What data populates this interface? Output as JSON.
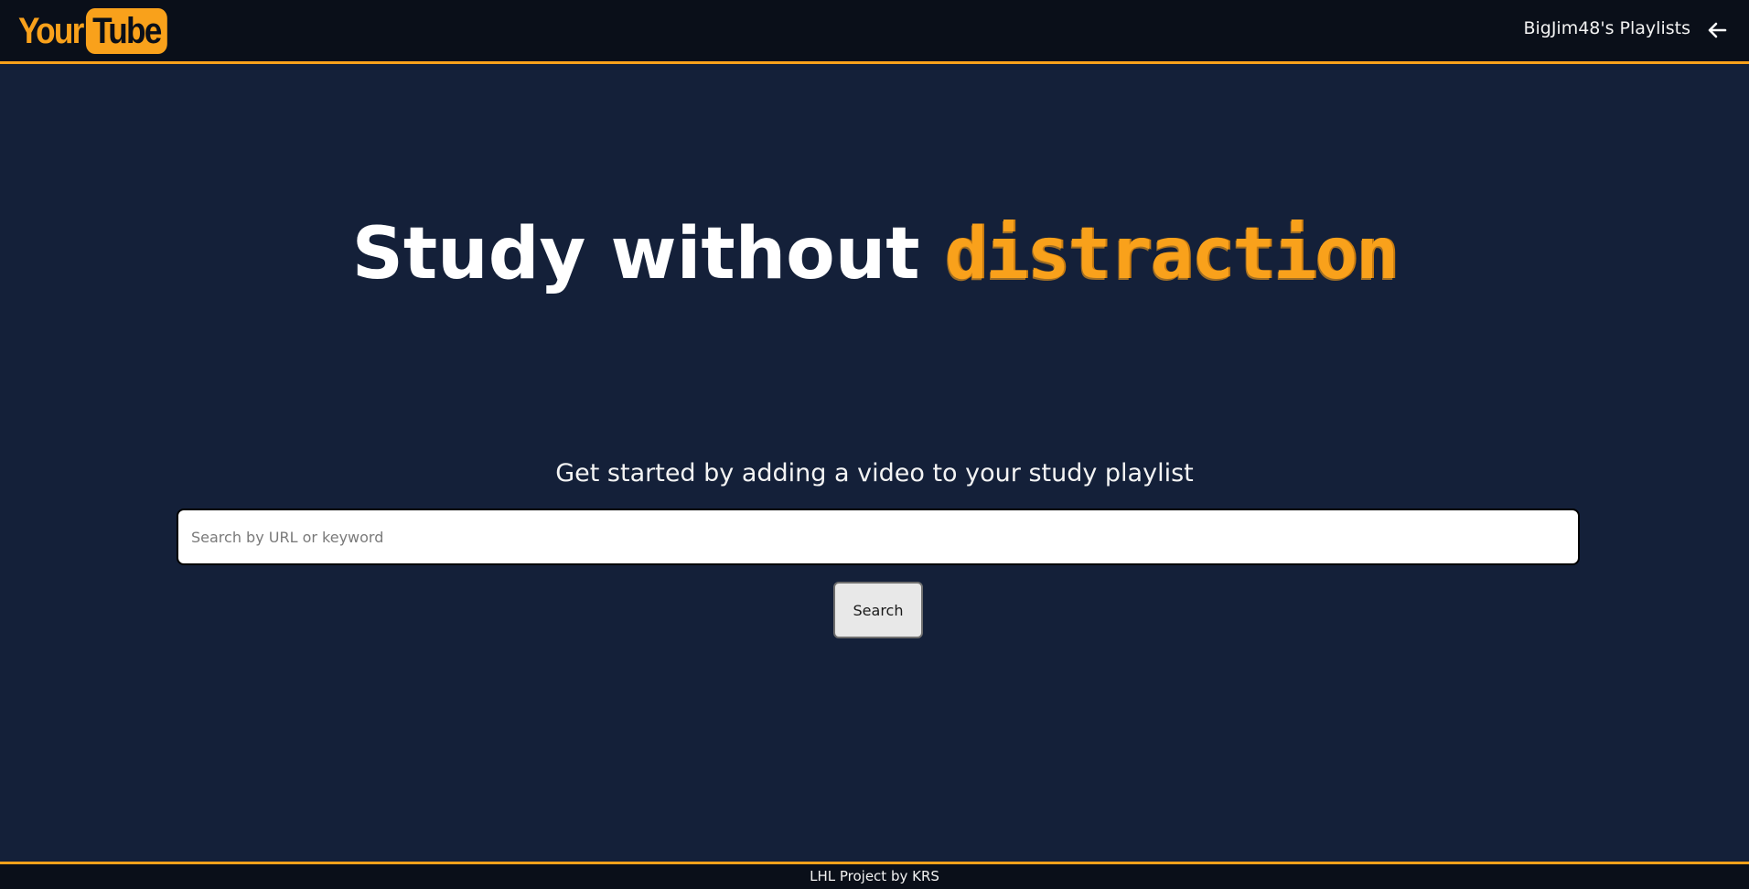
{
  "header": {
    "logo_part1": "Your",
    "logo_part2": "Tube",
    "playlists_link": "BigJim48's Playlists",
    "back_icon": "arrow-left-icon"
  },
  "hero": {
    "title_plain": "Study without ",
    "title_accent": "distraction"
  },
  "search": {
    "subtitle": "Get started by adding a video to your study playlist",
    "placeholder": "Search by URL or keyword",
    "value": "",
    "button_label": "Search"
  },
  "footer": {
    "text": "LHL Project by KRS"
  },
  "colors": {
    "accent": "#f9a11b",
    "background": "#142039",
    "bar": "#0a0f19"
  }
}
